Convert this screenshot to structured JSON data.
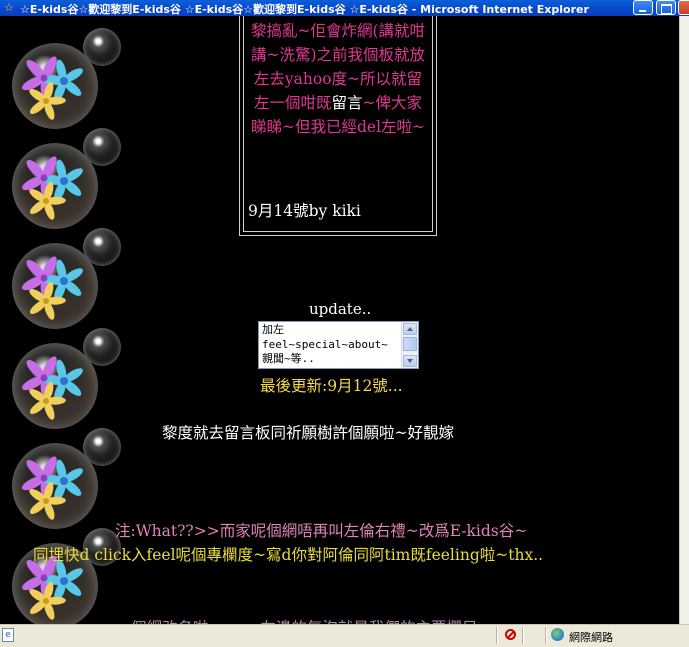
{
  "window": {
    "title": "☆E-kids谷☆歡迎黎到E-kids谷 ☆E-kids谷☆歡迎黎到E-kids谷 ☆E-kids谷 - Microsoft Internet Explorer"
  },
  "message_box": {
    "lines_pink_1": "黎搞亂~佢會炸網(講就咁講~洗驚)之前我個板就放左去yahoo度~所以就留左一個咁既",
    "highlight": "留言",
    "lines_pink_2": "~俾大家睇睇~但我已經del左啦~",
    "signature": "9月14號by kiki"
  },
  "update": {
    "label": "update..",
    "list_items": [
      "加左",
      "feel~special~about~",
      "親聞~等.."
    ],
    "last_update": "最後更新:9月12號..."
  },
  "notices": {
    "wish": "黎度就去留言板同祈願樹許個願啦~好靚嫁",
    "note1": "注:What??>>而家呢個網唔再叫左倫右禮~改爲E-kids谷~",
    "note2": "同埋快d click入feel呢個專欄度~寫d你對阿倫同阿tim既feeling啦~thx..",
    "note3": "~個網改名啦~~~~左邊的氣泡就是我們的主要欄目~"
  },
  "status_bar": {
    "page_icon": "e",
    "zone": "網際網路"
  },
  "colors": {
    "pink_text": "#e0378f",
    "yellow_text": "#f6d84a",
    "background": "#000000"
  },
  "icons": [
    "app-icon",
    "minimize-icon",
    "maximize-icon",
    "close-icon",
    "page-icon",
    "blocked-icon",
    "globe-icon",
    "bubble-flower-icon"
  ]
}
